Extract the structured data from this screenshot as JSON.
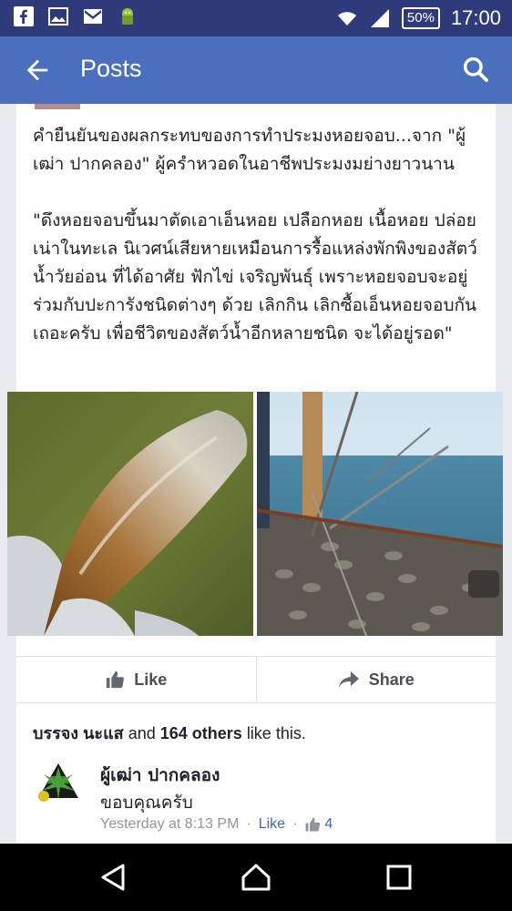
{
  "status_bar": {
    "battery": "50%",
    "time": "17:00",
    "icons": [
      "facebook-notification-icon",
      "gallery-notification-icon",
      "gmail-notification-icon",
      "android-notification-icon",
      "wifi-icon",
      "signal-icon",
      "battery-icon"
    ]
  },
  "app_bar": {
    "title": "Posts",
    "icons": [
      "back-arrow-icon",
      "search-icon"
    ]
  },
  "post": {
    "text": "คำยืนยันของผลกระทบของการทำประมงหอยจอบ...จาก \"ผู้เฒ่า ปากคลอง\" ผู้ครำหวอดในอาชีพประมงมย่างยาวนาน\n\n\"ดึงหอยจอบขึ้นมาตัดเอาเอ็นหอย เปลือกหอย เนื้อหอย ปล่อยเน่าในทะเล นิเวศน์เสียหายเหมือนการรื้อแหล่งพักพิงของสัตว์น้ำวัยอ่อน ที่ได้อาศัย ฟักไข่ เจริญพันธุ์ เพราะหอยจอบจะอยู่ร่วมกับปะการังชนิดต่างๆ ด้วย เลิกกิน เลิกซื้อเอ็นหอยจอบกันเถอะครับ เพื่อชีวิตของสัตว์น้ำอีกหลายชนิด จะได้อยู่รอด\""
  },
  "actions": {
    "like_label": "Like",
    "share_label": "Share"
  },
  "likes": {
    "name": "บรรจง นะแส",
    "and": "and",
    "others": "164 others",
    "suffix": "like this."
  },
  "comment": {
    "author": "ผู้เฒ่า ปากคลอง",
    "text": "ขอบคุณครับ",
    "time": "Yesterday at 8:13 PM",
    "dot": "·",
    "like_label": "Like",
    "like_count": "4"
  },
  "colors": {
    "status_bar": "#2f3a7a",
    "app_bar": "#4a6fbc",
    "link_blue": "#4267b2"
  }
}
